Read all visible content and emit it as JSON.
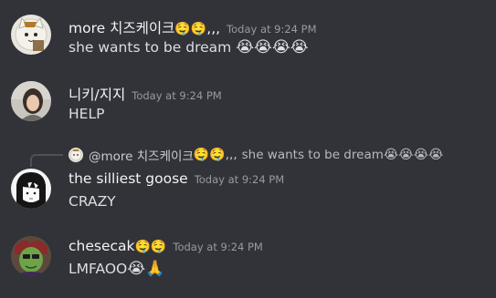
{
  "messages": [
    {
      "username": "more 치즈케이크",
      "username_emoji": "🤤🤤",
      "username_tail": ",,,",
      "timestamp": "Today at 9:24 PM",
      "text": "she wants to be dream ",
      "text_emoji": "😭😭😭😭"
    },
    {
      "username": "니키/지지",
      "timestamp": "Today at 9:24 PM",
      "text": "HELP"
    },
    {
      "reply": {
        "user": "@more 치즈케이크",
        "user_emoji": "🤤🤤",
        "user_tail": ",,,",
        "text": "she wants to be dream ",
        "text_emoji": "😭😭😭😭"
      },
      "username": "the silliest goose",
      "timestamp": "Today at 9:24 PM",
      "text": "CRAZY"
    },
    {
      "username": "chesecak",
      "username_emoji": "🤤🤤",
      "timestamp": "Today at 9:24 PM",
      "text": "LMFAOO",
      "text_emoji": "😭🙏"
    }
  ],
  "avatars": [
    "cat-avatar-icon",
    "girl-photo-avatar-icon",
    "anime-sketch-avatar-icon",
    "green-character-avatar-icon"
  ],
  "colors": {
    "background": "#323339",
    "username": "#f2f3f5",
    "message_text": "#dbdee1",
    "timestamp": "#949ba4",
    "reply_line": "#4e5058"
  }
}
